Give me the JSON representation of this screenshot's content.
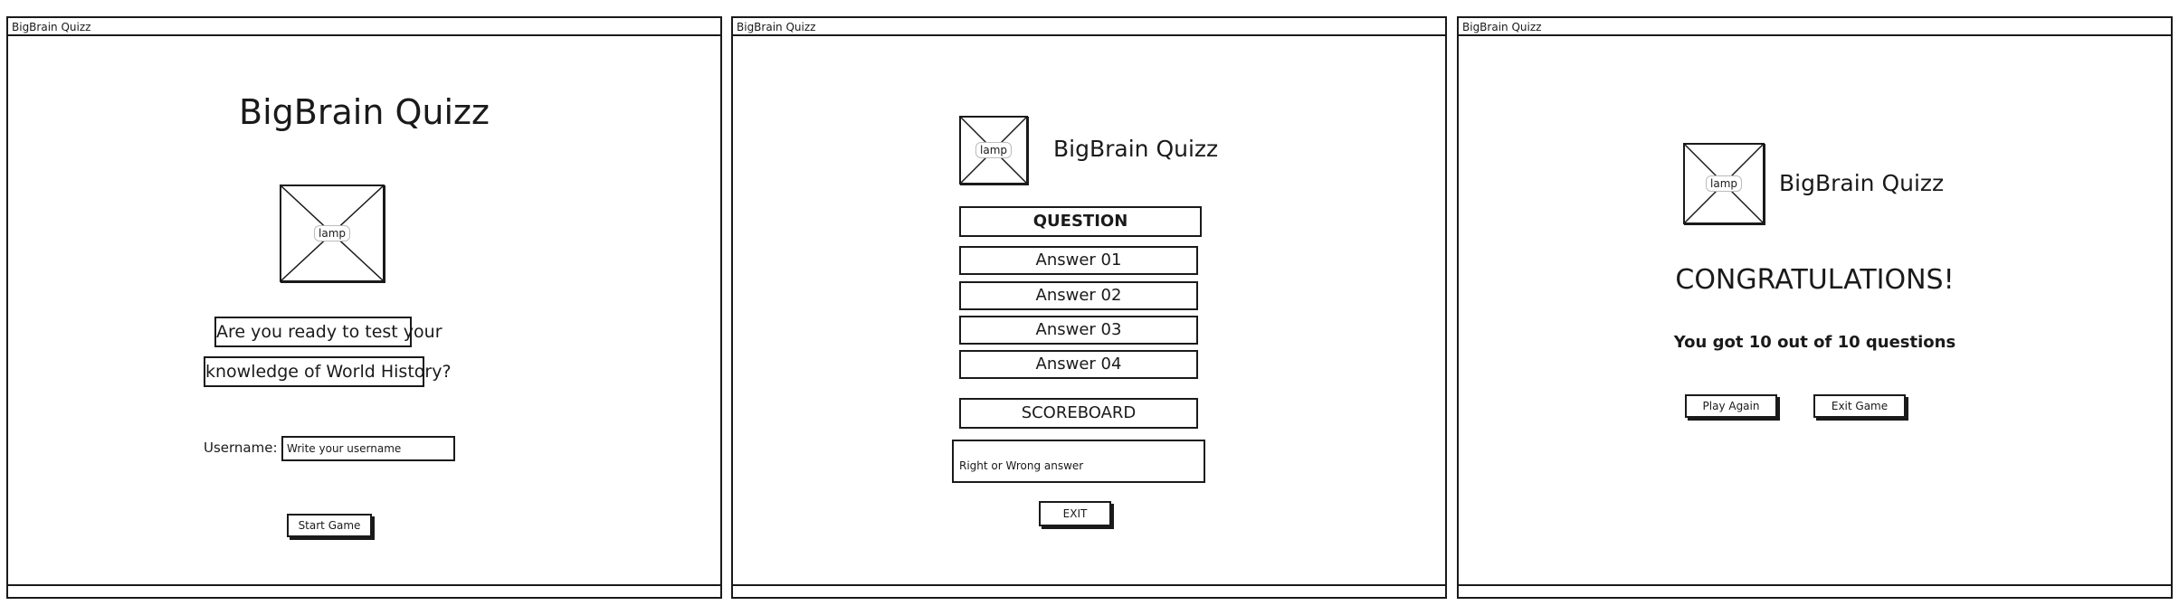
{
  "screens": [
    {
      "window_title": "BigBrain Quizz",
      "heading": "BigBrain Quizz",
      "image_label": "lamp",
      "intro_line_1": "Are you ready to test your",
      "intro_line_2": "knowledge of World History?",
      "username_label": "Username:",
      "username_placeholder": "Write your username",
      "start_button": "Start Game"
    },
    {
      "window_title": "BigBrain Quizz",
      "image_label": "lamp",
      "brand": "BigBrain Quizz",
      "question": "QUESTION",
      "answers": [
        "Answer 01",
        "Answer 02",
        "Answer 03",
        "Answer 04"
      ],
      "scoreboard": "SCOREBOARD",
      "feedback": "Right or Wrong answer",
      "exit_button": "EXIT"
    },
    {
      "window_title": "BigBrain Quizz",
      "image_label": "lamp",
      "brand": "BigBrain Quizz",
      "congrats": "CONGRATULATIONS!",
      "score_text": "You got 10 out of 10 questions",
      "play_again_button": "Play Again",
      "exit_game_button": "Exit Game"
    }
  ]
}
